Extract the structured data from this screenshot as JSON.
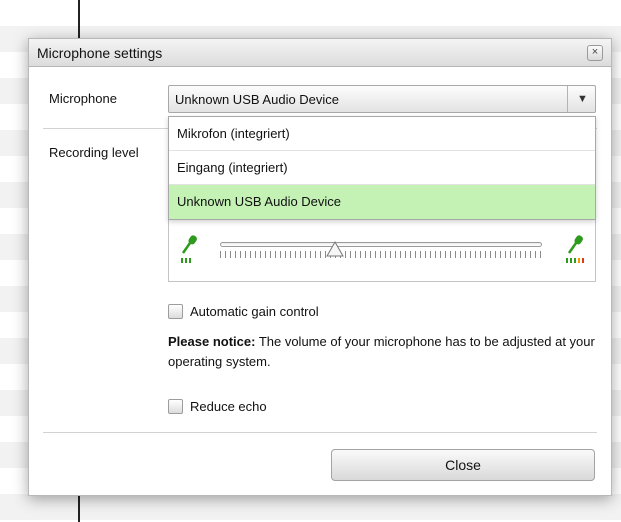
{
  "dialog": {
    "title": "Microphone settings",
    "close_glyph": "×"
  },
  "microphone": {
    "label": "Microphone",
    "selected": "Unknown USB Audio Device",
    "options": [
      "Mikrofon (integriert)",
      "Eingang (integriert)",
      "Unknown USB Audio Device"
    ],
    "arrow_glyph": "▼"
  },
  "recording_level": {
    "label": "Recording level",
    "level": 0.36
  },
  "agc": {
    "label": "Automatic gain control",
    "checked": false
  },
  "notice": {
    "bold": "Please notice:",
    "text": " The volume of your microphone has to be adjusted at your operating system."
  },
  "echo": {
    "label": "Reduce echo",
    "checked": false
  },
  "footer": {
    "close_label": "Close"
  },
  "colors": {
    "selected_option": "#c4f2b4",
    "mic_green": "#2e9a1e",
    "meter_orange": "#f29a00",
    "meter_red": "#e23b14"
  },
  "icons": [
    "microphone-low-icon",
    "microphone-high-icon",
    "slider-thumb-icon",
    "chevron-down-icon",
    "close-icon"
  ]
}
